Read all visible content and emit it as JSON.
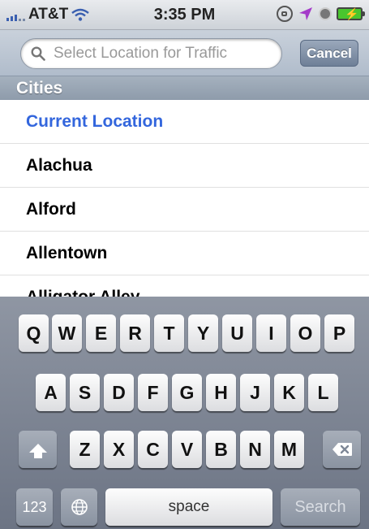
{
  "status_bar": {
    "carrier": "AT&T",
    "time": "3:35 PM",
    "colors": {
      "battery": "#49c62e",
      "location_arrow": "#a43ac9"
    }
  },
  "search": {
    "placeholder": "Select Location for Traffic",
    "cancel_label": "Cancel"
  },
  "list": {
    "section_title": "Cities",
    "items": [
      "Current Location",
      "Alachua",
      "Alford",
      "Allentown",
      "Alligator Alley"
    ]
  },
  "keyboard": {
    "row1": [
      "Q",
      "W",
      "E",
      "R",
      "T",
      "Y",
      "U",
      "I",
      "O",
      "P"
    ],
    "row2": [
      "A",
      "S",
      "D",
      "F",
      "G",
      "H",
      "J",
      "K",
      "L"
    ],
    "row3": [
      "Z",
      "X",
      "C",
      "V",
      "B",
      "N",
      "M"
    ],
    "numbers_label": "123",
    "space_label": "space",
    "search_label": "Search"
  }
}
